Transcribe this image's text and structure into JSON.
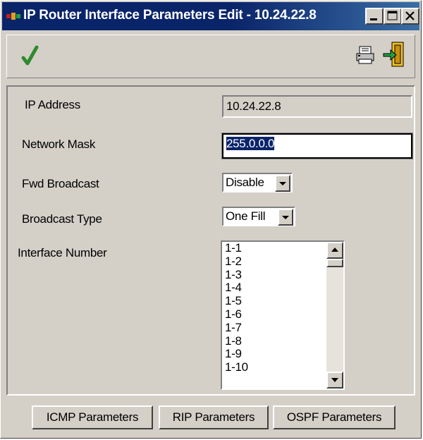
{
  "window": {
    "title": "IP Router Interface Parameters Edit - 10.24.22.8"
  },
  "toolbar": {
    "apply_icon": "checkmark-icon",
    "print_icon": "printer-icon",
    "exit_icon": "exit-door-icon"
  },
  "form": {
    "ip_address": {
      "label": "IP Address",
      "value": "10.24.22.8"
    },
    "network_mask": {
      "label": "Network Mask",
      "value": "255.0.0.0"
    },
    "fwd_broadcast": {
      "label": "Fwd Broadcast",
      "value": "Disable"
    },
    "broadcast_type": {
      "label": "Broadcast Type",
      "value": "One Fill"
    },
    "interface_number": {
      "label": "Interface Number",
      "items": [
        "1-1",
        "1-2",
        "1-3",
        "1-4",
        "1-5",
        "1-6",
        "1-7",
        "1-8",
        "1-9",
        "1-10"
      ]
    }
  },
  "buttons": {
    "icmp": "ICMP Parameters",
    "rip": "RIP Parameters",
    "ospf": "OSPF Parameters"
  },
  "colors": {
    "titlebar": "#0a246a",
    "face": "#d4d0c8",
    "check": "#2e8b2e"
  }
}
